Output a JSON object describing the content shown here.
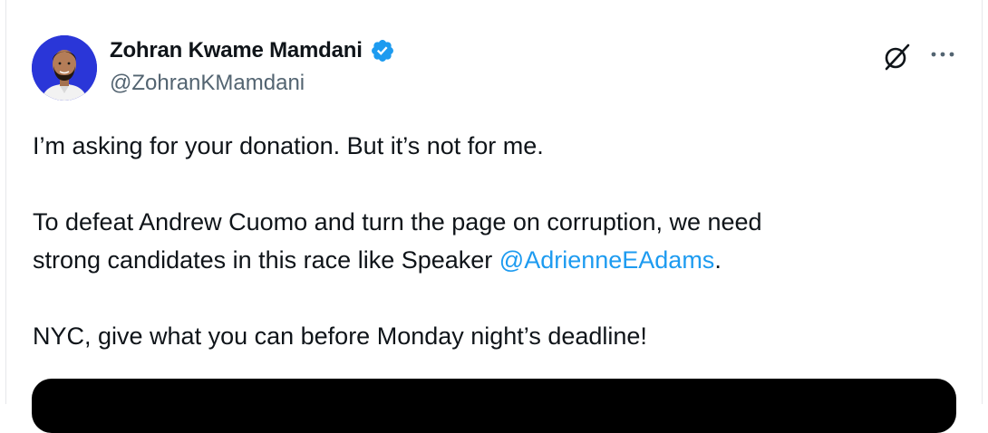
{
  "author": {
    "display_name": "Zohran Kwame Mamdani",
    "handle": "@ZohranKMamdani",
    "verified": true
  },
  "icons": {
    "verified": "verified-badge-icon",
    "grok": "grok-icon",
    "more": "more-options-icon"
  },
  "tweet": {
    "line1": "I’m asking for your donation. But it’s not for me.",
    "line2": "To defeat Andrew Cuomo and turn the page on corruption, we need",
    "line3_prefix": "strong candidates in this race like Speaker ",
    "line3_mention": "@AdrienneEAdams",
    "line3_suffix": ".",
    "line4": "NYC, give what you can before Monday night’s deadline!"
  },
  "colors": {
    "text": "#0f1419",
    "secondary": "#536471",
    "link": "#1d9bf0",
    "avatar_bg": "#2a36d8"
  }
}
